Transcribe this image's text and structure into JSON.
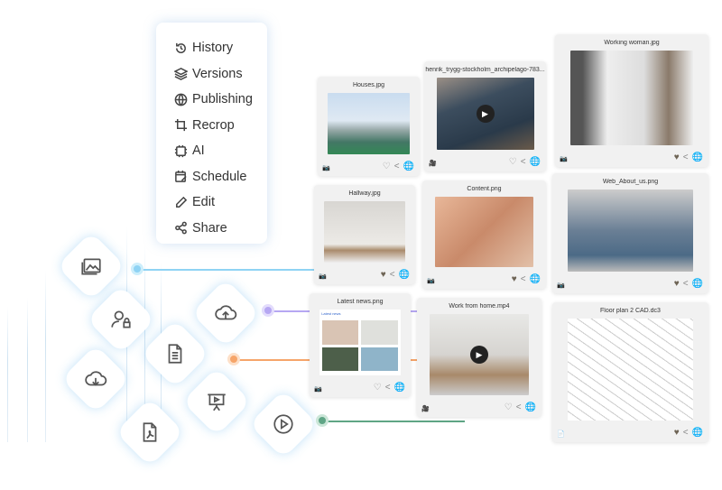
{
  "menu": {
    "items": [
      {
        "label": "History",
        "icon": "history-icon"
      },
      {
        "label": "Versions",
        "icon": "layers-icon"
      },
      {
        "label": "Publishing",
        "icon": "globe-icon"
      },
      {
        "label": "Recrop",
        "icon": "crop-icon"
      },
      {
        "label": "AI",
        "icon": "ai-chip-icon"
      },
      {
        "label": "Schedule",
        "icon": "calendar-edit-icon"
      },
      {
        "label": "Edit",
        "icon": "pencil-icon"
      },
      {
        "label": "Share",
        "icon": "share-icon"
      }
    ]
  },
  "connector_colors": {
    "blue": "#8fd3f4",
    "purple": "#b6a7f2",
    "orange": "#f6a56a",
    "green": "#5fa585"
  },
  "cards": [
    {
      "title": "Houses.jpg",
      "type": "camera-icon",
      "favorite": false
    },
    {
      "title": "henrik_trygg-stockholm_archipelago-783...",
      "type": "video-icon",
      "favorite": false
    },
    {
      "title": "Working woman.jpg",
      "type": "camera-icon",
      "favorite": true
    },
    {
      "title": "Hallway.jpg",
      "type": "camera-icon",
      "favorite": true
    },
    {
      "title": "Content.png",
      "type": "camera-icon",
      "favorite": true
    },
    {
      "title": "Web_About_us.png",
      "type": "camera-icon",
      "favorite": true
    },
    {
      "title": "Latest news.png",
      "type": "camera-icon",
      "favorite": false,
      "inner_label": "Latest news"
    },
    {
      "title": "Work from home.mp4",
      "type": "video-icon",
      "favorite": false
    },
    {
      "title": "Floor plan 2 CAD.dc3",
      "type": "document-icon",
      "favorite": true
    }
  ]
}
